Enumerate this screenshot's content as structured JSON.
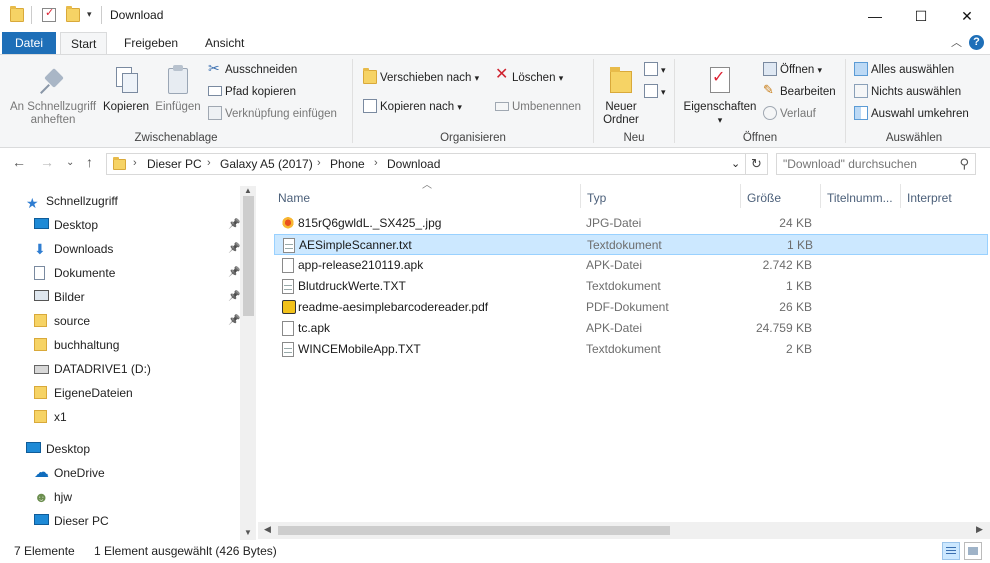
{
  "titlebar": {
    "title": "Download",
    "minimize": "—",
    "maximize": "☐",
    "close": "✕"
  },
  "tabs": [
    {
      "label": "Datei"
    },
    {
      "label": "Start"
    },
    {
      "label": "Freigeben"
    },
    {
      "label": "Ansicht"
    }
  ],
  "ribbon": {
    "clipboard": {
      "label": "Zwischenablage",
      "pin": "An Schnellzugriff anheften",
      "copy": "Kopieren",
      "paste": "Einfügen",
      "cut": "Ausschneiden",
      "copy_path": "Pfad kopieren",
      "paste_shortcut": "Verknüpfung einfügen"
    },
    "organize": {
      "label": "Organisieren",
      "move_to": "Verschieben nach",
      "copy_to": "Kopieren nach",
      "delete": "Löschen",
      "rename": "Umbenennen"
    },
    "new": {
      "label": "Neu",
      "new_folder": "Neuer Ordner"
    },
    "open": {
      "label": "Öffnen",
      "properties": "Eigenschaften",
      "open": "Öffnen",
      "edit": "Bearbeiten",
      "history": "Verlauf"
    },
    "select": {
      "label": "Auswählen",
      "select_all": "Alles auswählen",
      "select_none": "Nichts auswählen",
      "invert": "Auswahl umkehren"
    }
  },
  "address": {
    "crumbs": [
      "Dieser PC",
      "Galaxy A5 (2017)",
      "Phone",
      "Download"
    ],
    "search_placeholder": "\"Download\" durchsuchen"
  },
  "nav": {
    "quick_access": "Schnellzugriff",
    "items": [
      {
        "label": "Desktop",
        "pinned": true
      },
      {
        "label": "Downloads",
        "pinned": true
      },
      {
        "label": "Dokumente",
        "pinned": true
      },
      {
        "label": "Bilder",
        "pinned": true
      },
      {
        "label": "source",
        "pinned": true
      },
      {
        "label": "buchhaltung",
        "pinned": false
      },
      {
        "label": "DATADRIVE1 (D:)",
        "pinned": false
      },
      {
        "label": "EigeneDateien",
        "pinned": false
      },
      {
        "label": "x1",
        "pinned": false
      }
    ],
    "desktop": "Desktop",
    "onedrive": "OneDrive",
    "user": "hjw",
    "this_pc": "Dieser PC"
  },
  "columns": {
    "name": "Name",
    "type": "Typ",
    "size": "Größe",
    "title": "Titelnumm...",
    "artist": "Interpret"
  },
  "files": [
    {
      "name": "815rQ6gwldL._SX425_.jpg",
      "type": "JPG-Datei",
      "size": "24 KB",
      "icon": "image-icon",
      "selected": false
    },
    {
      "name": "AESimpleScanner.txt",
      "type": "Textdokument",
      "size": "1 KB",
      "icon": "text-file-icon",
      "selected": true
    },
    {
      "name": "app-release210119.apk",
      "type": "APK-Datei",
      "size": "2.742 KB",
      "icon": "file-icon",
      "selected": false
    },
    {
      "name": "BlutdruckWerte.TXT",
      "type": "Textdokument",
      "size": "1 KB",
      "icon": "text-file-icon",
      "selected": false
    },
    {
      "name": "readme-aesimplebarcodereader.pdf",
      "type": "PDF-Dokument",
      "size": "26 KB",
      "icon": "pdf-icon",
      "selected": false
    },
    {
      "name": "tc.apk",
      "type": "APK-Datei",
      "size": "24.759 KB",
      "icon": "file-icon",
      "selected": false
    },
    {
      "name": "WINCEMobileApp.TXT",
      "type": "Textdokument",
      "size": "2 KB",
      "icon": "text-file-icon",
      "selected": false
    }
  ],
  "status": {
    "count": "7 Elemente",
    "selection": "1 Element ausgewählt (426 Bytes)"
  },
  "colors": {
    "accent": "#1e6fb8",
    "selection_bg": "#cce8ff",
    "selection_border": "#99d1ff",
    "folder": "#f6d365"
  }
}
